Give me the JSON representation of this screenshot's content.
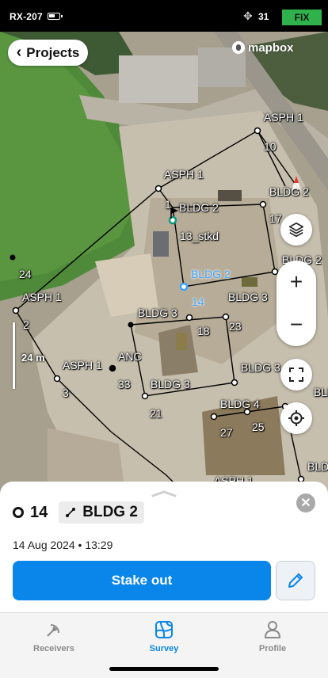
{
  "status_bar": {
    "receiver": "RX-207",
    "satellite_count": "31",
    "fix_status": "FIX",
    "fix_color": "#2fb24c"
  },
  "map": {
    "back_button_label": "Projects",
    "attribution": "mapbox",
    "scale_label": "24 m",
    "labels": [
      {
        "text": "ASPH 1",
        "kind": "code"
      },
      {
        "text": "10",
        "kind": "number"
      },
      {
        "text": "ASPH 1",
        "kind": "code"
      },
      {
        "text": "BLDG 2",
        "kind": "code"
      },
      {
        "text": "1",
        "kind": "number"
      },
      {
        "text": "BLDG 2",
        "kind": "code"
      },
      {
        "text": "17",
        "kind": "number"
      },
      {
        "text": "13_stkd",
        "kind": "code"
      },
      {
        "text": "BLDG 2",
        "kind": "code"
      },
      {
        "text": "24",
        "kind": "number"
      },
      {
        "text": "BLDG 2",
        "kind": "selected"
      },
      {
        "text": "14",
        "kind": "selected"
      },
      {
        "text": "ASPH 1",
        "kind": "code"
      },
      {
        "text": "BLDG 3",
        "kind": "code"
      },
      {
        "text": "BLDG 3",
        "kind": "code"
      },
      {
        "text": "2",
        "kind": "number"
      },
      {
        "text": "18",
        "kind": "number"
      },
      {
        "text": "23",
        "kind": "number"
      },
      {
        "text": "ANC",
        "kind": "code"
      },
      {
        "text": "ASPH 1",
        "kind": "code"
      },
      {
        "text": "BLDG 3",
        "kind": "code"
      },
      {
        "text": "33",
        "kind": "number"
      },
      {
        "text": "BLDG 3",
        "kind": "code"
      },
      {
        "text": "3",
        "kind": "number"
      },
      {
        "text": "BLDG 4",
        "kind": "code"
      },
      {
        "text": "21",
        "kind": "number"
      },
      {
        "text": "BLDG 4",
        "kind": "code"
      },
      {
        "text": "25",
        "kind": "number"
      },
      {
        "text": "27",
        "kind": "number"
      },
      {
        "text": "BLD",
        "kind": "code"
      },
      {
        "text": "ASPH 1",
        "kind": "code"
      }
    ],
    "zoom_in_symbol": "+",
    "zoom_out_symbol": "−",
    "selected_color": "#3aa5ff"
  },
  "sheet": {
    "point_number": "14",
    "code": "BLDG 2",
    "timestamp": "14 Aug 2024 • 13:29",
    "stake_out_label": "Stake out",
    "close_symbol": "✕"
  },
  "tabs": [
    {
      "label": "Receivers",
      "icon": "receiver-icon",
      "active": false
    },
    {
      "label": "Survey",
      "icon": "survey-map-icon",
      "active": true
    },
    {
      "label": "Profile",
      "icon": "person-icon",
      "active": false
    }
  ],
  "colors": {
    "accent": "#0a86ea",
    "fix_green": "#2fb24c"
  }
}
